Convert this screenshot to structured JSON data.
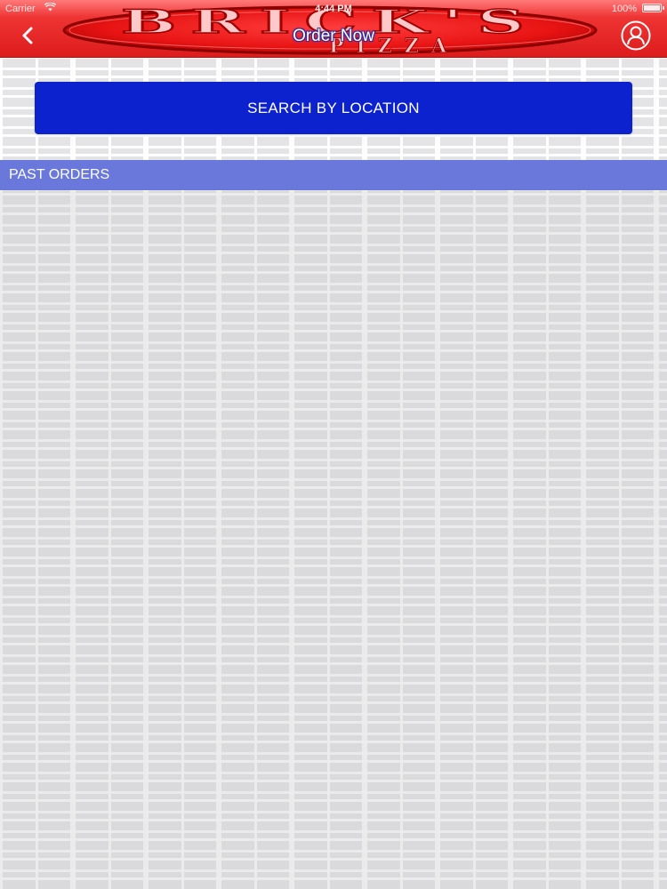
{
  "status_bar": {
    "carrier": "Carrier",
    "time": "4:44 PM",
    "battery": "100%"
  },
  "header": {
    "brand_line1": "BRICK'S",
    "brand_line2": "PIZZA",
    "title": "Order Now",
    "back_icon": "chevron-left-icon",
    "profile_icon": "user-profile-icon"
  },
  "main": {
    "search_button_label": "SEARCH BY LOCATION",
    "past_orders_label": "PAST ORDERS",
    "past_orders": []
  },
  "colors": {
    "header_red": "#dd1c1c",
    "button_blue": "#0d22cf",
    "section_header": "#6a78dc",
    "background": "#e4e4e6"
  }
}
